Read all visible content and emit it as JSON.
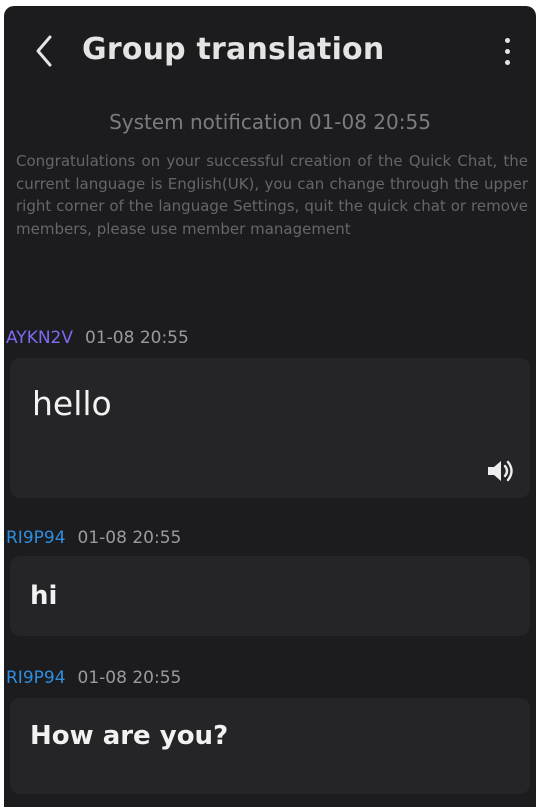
{
  "header": {
    "title": "Group translation",
    "back_icon": "chevron-left-icon",
    "menu_icon": "more-vertical-icon"
  },
  "system_notification": {
    "time_label": "System notification 01-08 20:55",
    "text": "Congratulations on your successful creation of the Quick Chat, the current language is English(UK), you can change through the upper right corner of the language Settings, quit the quick chat or remove members, please use member management"
  },
  "messages": [
    {
      "sender": "AYKN2V",
      "time": "01-08 20:55",
      "text": "hello",
      "has_speaker": true,
      "sender_color": "#7b6cf0"
    },
    {
      "sender": "RI9P94",
      "time": "01-08 20:55",
      "text": "hi",
      "has_speaker": false,
      "sender_color": "#2f8ee0"
    },
    {
      "sender": "RI9P94",
      "time": "01-08 20:55",
      "text": "How are you?",
      "has_speaker": false,
      "sender_color": "#2f8ee0"
    }
  ],
  "colors": {
    "background": "#1c1c1e",
    "bubble": "#252528",
    "title": "#e4e4e4"
  }
}
